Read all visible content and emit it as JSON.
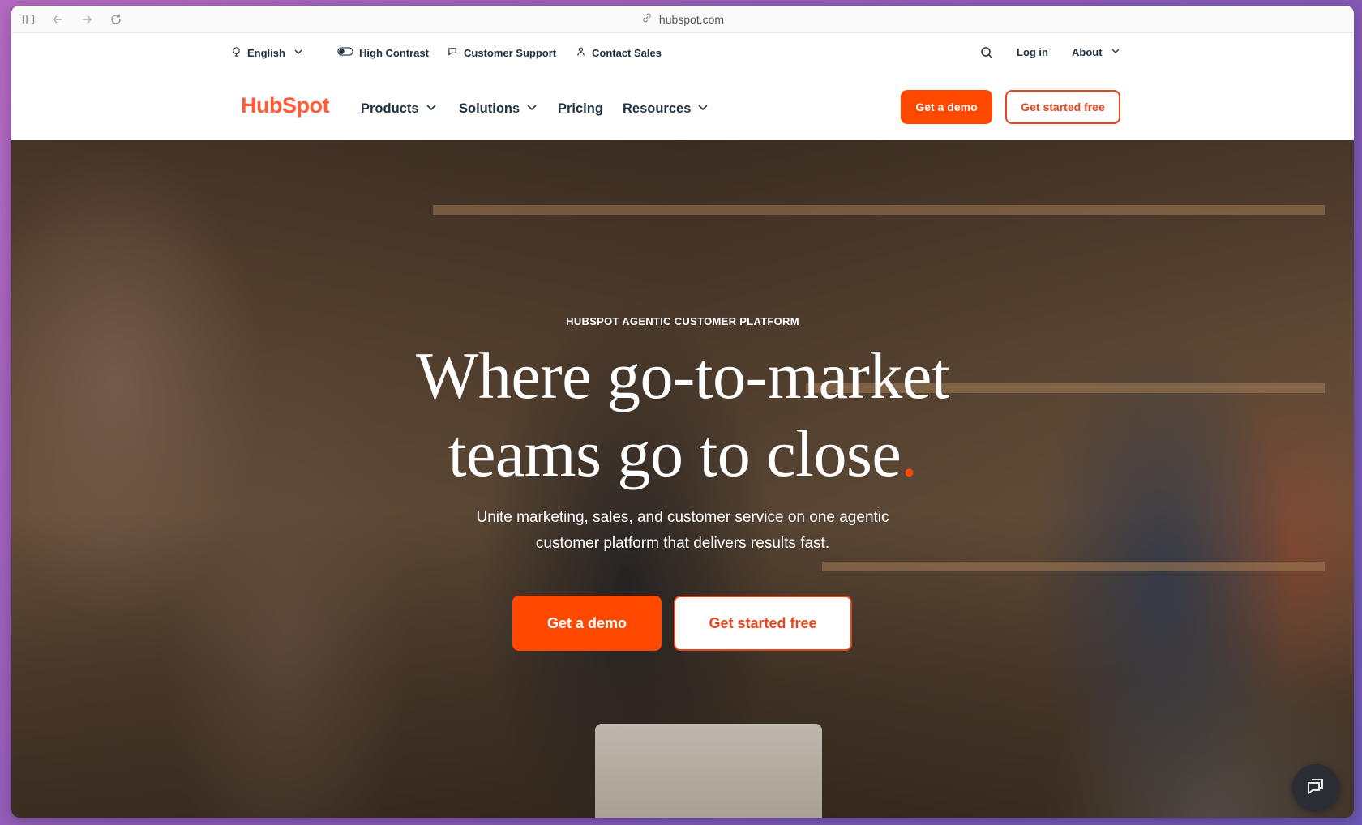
{
  "browser": {
    "url": "hubspot.com"
  },
  "utility_bar": {
    "language": "English",
    "high_contrast": "High Contrast",
    "customer_support": "Customer Support",
    "contact_sales": "Contact Sales",
    "log_in": "Log in",
    "about": "About"
  },
  "nav": {
    "logo_text": "HubSpot",
    "items": [
      "Products",
      "Solutions",
      "Pricing",
      "Resources"
    ],
    "demo_button": "Get a demo",
    "start_button": "Get started free"
  },
  "hero": {
    "eyebrow": "HUBSPOT AGENTIC CUSTOMER PLATFORM",
    "headline_line1": "Where go-to-market",
    "headline_line2": "teams go to close",
    "headline_dot": ".",
    "subtitle_line1": "Unite marketing, sales, and customer service on one agentic",
    "subtitle_line2": "customer platform that delivers results fast.",
    "demo_button": "Get a demo",
    "start_button": "Get started free"
  },
  "colors": {
    "brand_orange": "#ff4800",
    "text_dark": "#213343"
  }
}
